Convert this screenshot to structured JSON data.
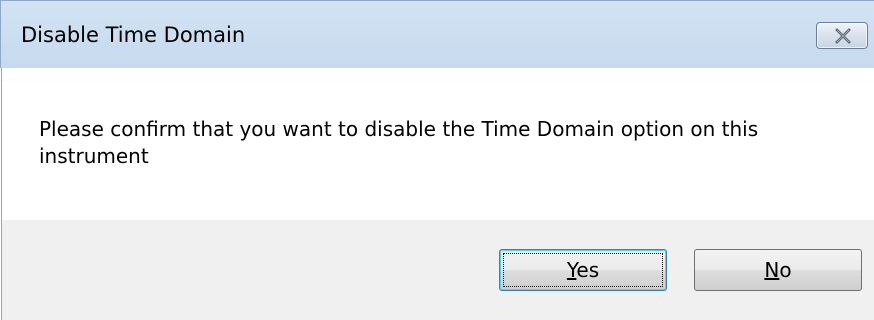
{
  "window": {
    "title": "Disable Time Domain",
    "close_icon": "close-x-icon"
  },
  "message": {
    "text": "Please confirm that you want to disable the Time Domain option on this instrument"
  },
  "buttons": {
    "yes": {
      "mnemonic": "Y",
      "rest": "es",
      "focused": true
    },
    "no": {
      "mnemonic": "N",
      "rest": "o",
      "focused": false
    }
  }
}
